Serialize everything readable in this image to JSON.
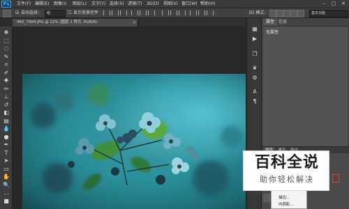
{
  "app": {
    "logo": "Ps"
  },
  "menu": {
    "items": [
      "文件(F)",
      "编辑(E)",
      "图像(I)",
      "图层(L)",
      "文字(Y)",
      "选择(S)",
      "滤镜(T)",
      "3D(D)",
      "视图(V)",
      "窗口(W)",
      "帮助(H)"
    ],
    "window_controls": [
      "–",
      "▢",
      "✕"
    ]
  },
  "options": {
    "auto_select_label": "自动选择：",
    "auto_select_value": "组",
    "show_transform_label": "显示变换控件",
    "mode_3d_label": "3D 模式：",
    "workspace": "基本功能"
  },
  "document": {
    "tab_title": "IMG_7904.JPG @ 12% (图层 1 拷贝, RGB/8)",
    "close_glyph": "×"
  },
  "tools": [
    {
      "name": "move-tool-icon",
      "glyph": "✥"
    },
    {
      "name": "marquee-tool-icon",
      "glyph": "⬚"
    },
    {
      "name": "lasso-tool-icon",
      "glyph": "◌"
    },
    {
      "name": "quick-select-tool-icon",
      "glyph": "✎"
    },
    {
      "name": "crop-tool-icon",
      "glyph": "⌗"
    },
    {
      "name": "eyedropper-tool-icon",
      "glyph": "✐"
    },
    {
      "name": "healing-tool-icon",
      "glyph": "✚"
    },
    {
      "name": "brush-tool-icon",
      "glyph": "✏"
    },
    {
      "name": "clone-stamp-tool-icon",
      "glyph": "⊥"
    },
    {
      "name": "history-brush-tool-icon",
      "glyph": "↺"
    },
    {
      "name": "eraser-tool-icon",
      "glyph": "◧"
    },
    {
      "name": "gradient-tool-icon",
      "glyph": "▤"
    },
    {
      "name": "blur-tool-icon",
      "glyph": "💧"
    },
    {
      "name": "dodge-tool-icon",
      "glyph": "●"
    },
    {
      "name": "pen-tool-icon",
      "glyph": "✒"
    },
    {
      "name": "type-tool-icon",
      "glyph": "T"
    },
    {
      "name": "path-select-tool-icon",
      "glyph": "➤"
    },
    {
      "name": "shape-tool-icon",
      "glyph": "▭"
    },
    {
      "name": "hand-tool-icon",
      "glyph": "✋"
    },
    {
      "name": "zoom-tool-icon",
      "glyph": "🔍"
    },
    {
      "name": "more-tools-icon",
      "glyph": "…"
    },
    {
      "name": "color-swatch-icon",
      "glyph": "■"
    }
  ],
  "side_icons": [
    {
      "name": "history-panel-icon",
      "glyph": "▦"
    },
    {
      "name": "actions-panel-icon",
      "glyph": "▶"
    },
    {
      "name": "layer-comps-icon",
      "glyph": "❐"
    },
    {
      "name": "brush-panel-icon",
      "glyph": "❦"
    },
    {
      "name": "adjustments-icon",
      "glyph": "⚙"
    },
    {
      "name": "character-panel-icon",
      "glyph": "A"
    },
    {
      "name": "paragraph-panel-icon",
      "glyph": "¶"
    }
  ],
  "panel": {
    "tab_properties": "属性",
    "tab_info": "信息",
    "no_properties": "无属性",
    "layer_tabs": [
      "图层",
      "通道",
      "路径"
    ]
  },
  "context_menu": {
    "items": [
      "描边...",
      "内阴影..."
    ]
  },
  "watermark": {
    "title": "百科全说",
    "subtitle": "助你轻松解决"
  },
  "colors": {
    "accent": "#31a8ff",
    "bg": "#2b2b2b",
    "panel": "#535353"
  }
}
